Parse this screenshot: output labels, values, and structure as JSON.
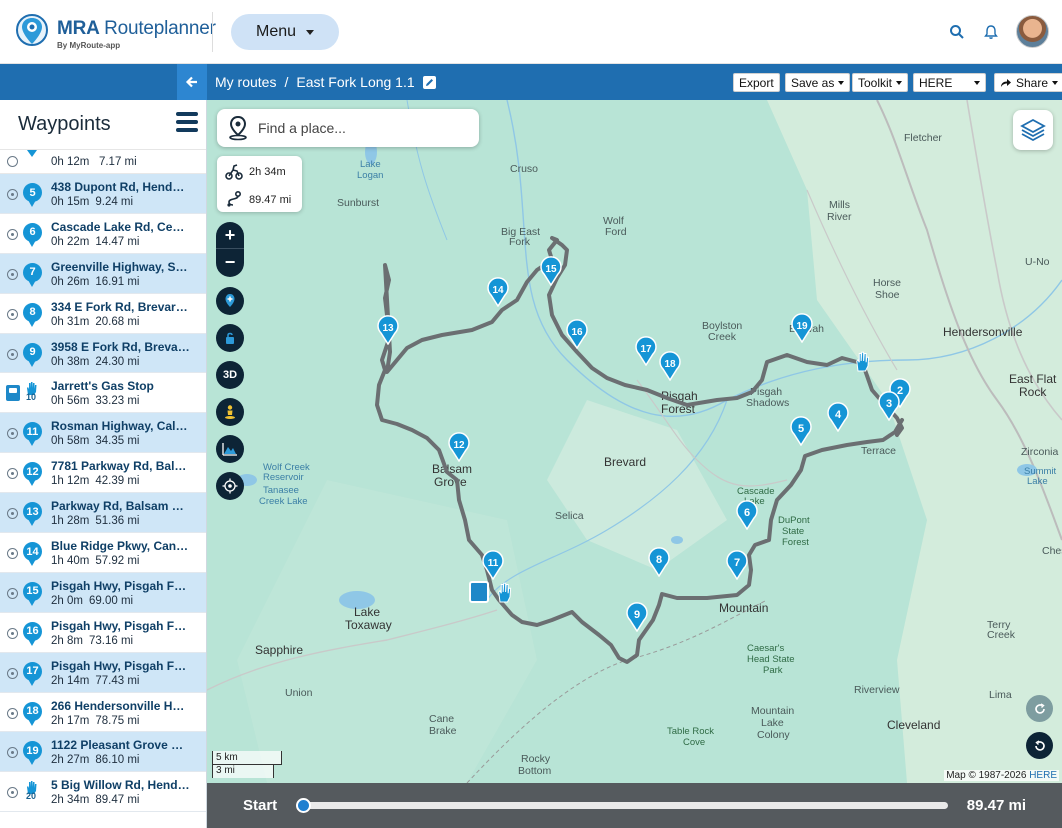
{
  "header": {
    "brand_bold": "MRA",
    "brand_light": "Routeplanner",
    "brand_sub": "By MyRoute-app",
    "menu_label": "Menu"
  },
  "routebar": {
    "crumb_root": "My routes",
    "crumb_sep": "/",
    "route_name": "East Fork Long 1.1",
    "export_label": "Export",
    "saveas_label": "Save as",
    "toolkit_label": "Toolkit",
    "provider_label": "HERE",
    "share_label": "Share"
  },
  "sidebar": {
    "title": "Waypoints",
    "partial": {
      "time": "0h 12m",
      "dist": "7.17 mi"
    },
    "items": [
      {
        "num": "5",
        "name": "438 Dupont Rd, Hender...",
        "time": "0h 15m",
        "dist": "9.24 mi",
        "kind": "pin"
      },
      {
        "num": "6",
        "name": "Cascade Lake Rd, Ceda...",
        "time": "0h 22m",
        "dist": "14.47 mi",
        "kind": "pin"
      },
      {
        "num": "7",
        "name": "Greenville Highway, Se...",
        "time": "0h 26m",
        "dist": "16.91 mi",
        "kind": "pin"
      },
      {
        "num": "8",
        "name": "334 E Fork Rd, Brevard, ...",
        "time": "0h 31m",
        "dist": "20.68 mi",
        "kind": "pin"
      },
      {
        "num": "9",
        "name": "3958 E Fork Rd, Brevard...",
        "time": "0h 38m",
        "dist": "24.30 mi",
        "kind": "pin"
      },
      {
        "num": "10",
        "name": "Jarrett's Gas Stop",
        "time": "0h 56m",
        "dist": "33.23 mi",
        "kind": "fuel"
      },
      {
        "num": "11",
        "name": "Rosman Highway, Calv...",
        "time": "0h 58m",
        "dist": "34.35 mi",
        "kind": "pin"
      },
      {
        "num": "12",
        "name": "7781 Parkway Rd, Balsa...",
        "time": "1h 12m",
        "dist": "42.39 mi",
        "kind": "pin"
      },
      {
        "num": "13",
        "name": "Parkway Rd, Balsam Gr...",
        "time": "1h 28m",
        "dist": "51.36 mi",
        "kind": "pin"
      },
      {
        "num": "14",
        "name": "Blue Ridge Pkwy, Canto...",
        "time": "1h 40m",
        "dist": "57.92 mi",
        "kind": "pin"
      },
      {
        "num": "15",
        "name": "Pisgah Hwy, Pisgah For...",
        "time": "2h 0m",
        "dist": "69.00 mi",
        "kind": "pin"
      },
      {
        "num": "16",
        "name": "Pisgah Hwy, Pisgah For...",
        "time": "2h 8m",
        "dist": "73.16 mi",
        "kind": "pin"
      },
      {
        "num": "17",
        "name": "Pisgah Hwy, Pisgah For...",
        "time": "2h 14m",
        "dist": "77.43 mi",
        "kind": "pin"
      },
      {
        "num": "18",
        "name": "266 Hendersonville Hw...",
        "time": "2h 17m",
        "dist": "78.75 mi",
        "kind": "pin"
      },
      {
        "num": "19",
        "name": "1122 Pleasant Grove Rd...",
        "time": "2h 27m",
        "dist": "86.10 mi",
        "kind": "pin"
      },
      {
        "num": "20",
        "name": "5 Big Willow Rd, Hende...",
        "time": "2h 34m",
        "dist": "89.47 mi",
        "kind": "hand"
      }
    ]
  },
  "map": {
    "search_placeholder": "Find a place...",
    "stat_time": "2h 34m",
    "stat_distance": "89.47 mi",
    "ctrl_3d": "3D",
    "scale_km": "5 km",
    "scale_mi": "3 mi",
    "copyright": "Map © 1987-2026",
    "copyright_here": "HERE",
    "route_color": "#6b6f72",
    "pin_color": "#1595d6",
    "places": [
      {
        "name": "Fletcher"
      },
      {
        "name": "Mills River"
      },
      {
        "name": "Horse Shoe"
      },
      {
        "name": "Hendersonville"
      },
      {
        "name": "U-No"
      },
      {
        "name": "East Flat Rock"
      },
      {
        "name": "Zirconia"
      },
      {
        "name": "Etowah"
      },
      {
        "name": "Boylston Creek"
      },
      {
        "name": "Pisgah Forest"
      },
      {
        "name": "Pisgah Shadows"
      },
      {
        "name": "Jeter Mountain Terrace"
      },
      {
        "name": "Brevard"
      },
      {
        "name": "Cascade Lake"
      },
      {
        "name": "DuPont State Forest"
      },
      {
        "name": "Cedar Mountain"
      },
      {
        "name": "Selica"
      },
      {
        "name": "Balsam Grove"
      },
      {
        "name": "Rosman"
      },
      {
        "name": "Lake Toxaway"
      },
      {
        "name": "Sapphire"
      },
      {
        "name": "Union"
      },
      {
        "name": "Cane Brake"
      },
      {
        "name": "Rocky Bottom"
      },
      {
        "name": "Table Rock Cove"
      },
      {
        "name": "Caesar's Head State Park"
      },
      {
        "name": "Mountain Lake Colony"
      },
      {
        "name": "Riverview"
      },
      {
        "name": "Cleveland"
      },
      {
        "name": "Lima"
      },
      {
        "name": "Terry Creek"
      },
      {
        "name": "Cruso"
      },
      {
        "name": "Big East Fork"
      },
      {
        "name": "Wolf Fork"
      },
      {
        "name": "Sunburst"
      },
      {
        "name": "Lake Logan"
      },
      {
        "name": "Wolf Creek Reservoir"
      },
      {
        "name": "Tanasee Creek Lake"
      },
      {
        "name": "Summit Lake"
      },
      {
        "name": "Chesnut"
      }
    ]
  },
  "playback": {
    "start_label": "Start",
    "total_distance": "89.47 mi",
    "progress": 0
  }
}
